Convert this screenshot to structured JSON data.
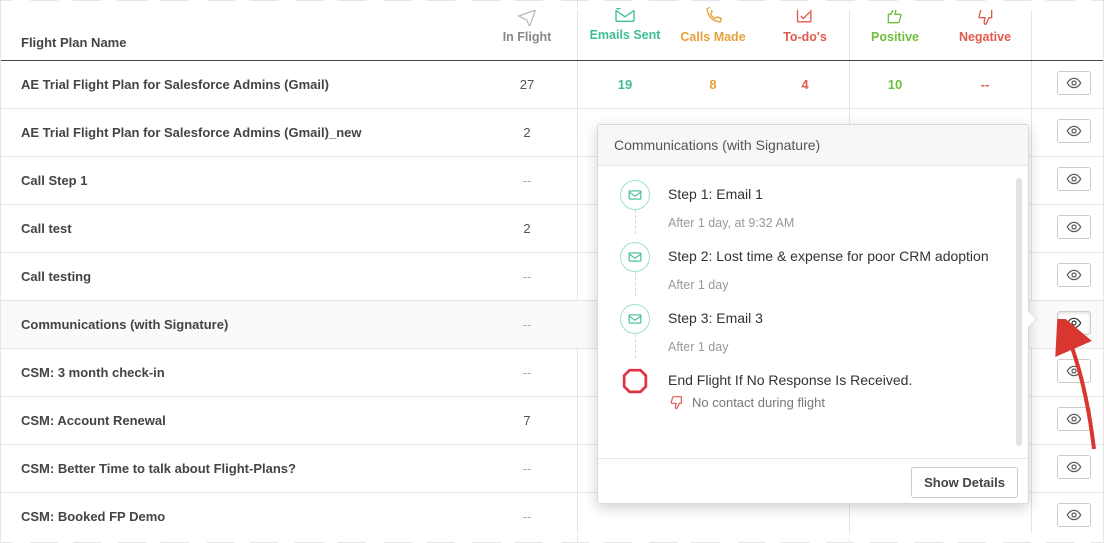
{
  "columns": {
    "name": "Flight Plan Name",
    "inflight": "In Flight",
    "emails": "Emails Sent",
    "calls": "Calls Made",
    "todos": "To-do's",
    "positive": "Positive",
    "negative": "Negative"
  },
  "rows": [
    {
      "name": "AE Trial Flight Plan for Salesforce Admins (Gmail)",
      "inflight": "27",
      "emails": "19",
      "calls": "8",
      "todos": "4",
      "positive": "10",
      "negative": "--"
    },
    {
      "name": "AE Trial Flight Plan for Salesforce Admins (Gmail)_new",
      "inflight": "2"
    },
    {
      "name": "Call Step 1",
      "inflight": "--"
    },
    {
      "name": "Call test",
      "inflight": "2"
    },
    {
      "name": "Call testing",
      "inflight": "--"
    },
    {
      "name": "Communications (with Signature)",
      "inflight": "--"
    },
    {
      "name": "CSM: 3 month check-in",
      "inflight": "--"
    },
    {
      "name": "CSM: Account Renewal",
      "inflight": "7"
    },
    {
      "name": "CSM: Better Time to talk about Flight-Plans?",
      "inflight": "--"
    },
    {
      "name": "CSM: Booked FP Demo",
      "inflight": "--"
    }
  ],
  "popover": {
    "title": "Communications (with Signature)",
    "steps": [
      {
        "title": "Step 1: Email 1",
        "meta": "After 1 day, at 9:32 AM"
      },
      {
        "title": "Step 2: Lost time & expense for poor CRM adoption",
        "meta": "After 1 day"
      },
      {
        "title": "Step 3: Email 3",
        "meta": "After 1 day"
      }
    ],
    "end": {
      "title": "End Flight If No Response Is Received.",
      "sub": "No contact during flight"
    },
    "button": "Show Details"
  },
  "icons": {
    "plane": "plane-icon",
    "mail": "mail-icon",
    "phone": "phone-icon",
    "check": "check-icon",
    "thumbup": "thumb-up-icon",
    "thumbdown": "thumb-down-icon",
    "eye": "eye-icon",
    "stop": "stop-icon"
  },
  "colors": {
    "emails": "#3fbf8f",
    "calls": "#e6a23c",
    "todos": "#e15b4c",
    "positive": "#6fbf3f",
    "negative": "#e15b4c"
  }
}
